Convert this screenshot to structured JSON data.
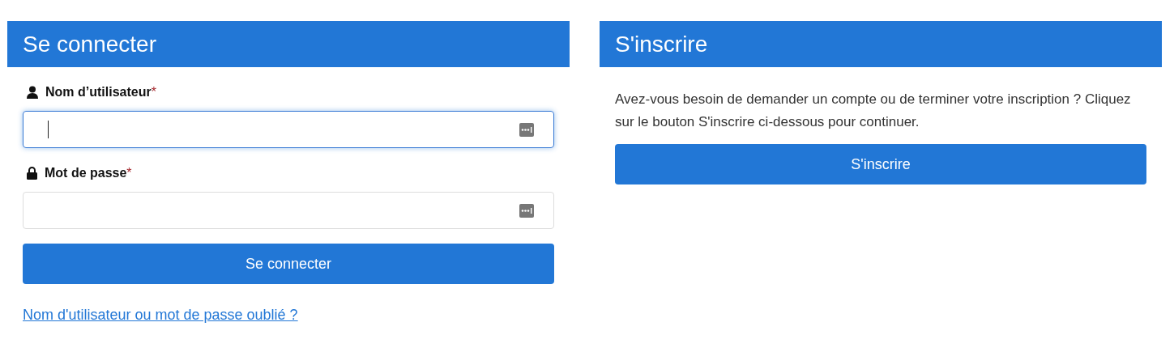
{
  "login": {
    "title": "Se connecter",
    "fields": [
      {
        "kind": "user",
        "label": "Nom d’utilisateur",
        "required_mark": "*",
        "focused": true
      },
      {
        "kind": "lock",
        "label": "Mot de passe",
        "required_mark": "*",
        "focused": false
      }
    ],
    "button": "Se connecter",
    "link": "Nom d'utilisateur ou mot de passe oublié ?"
  },
  "register": {
    "title": "S'inscrire",
    "text": "Avez-vous besoin de demander un compte ou de terminer votre inscription ? Cliquez sur le bouton S'inscrire ci-dessous pour continuer.",
    "button": "S'inscrire"
  }
}
